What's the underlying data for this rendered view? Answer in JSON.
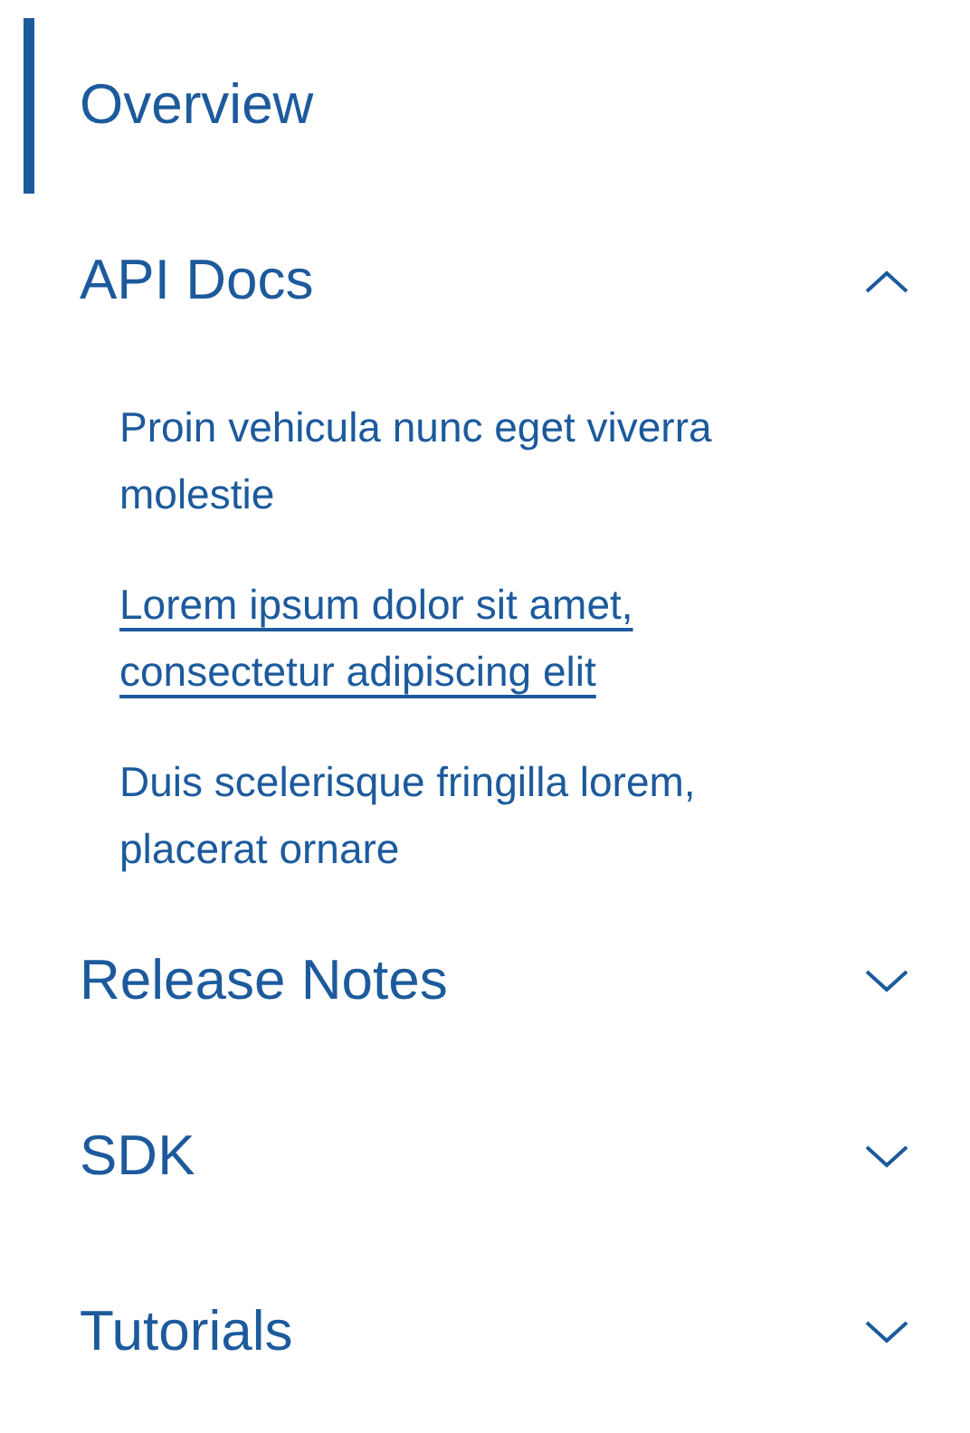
{
  "nav": {
    "items": [
      {
        "label": "Overview",
        "kind": "link",
        "selected": true
      },
      {
        "label": "API Docs",
        "kind": "section",
        "selected": false,
        "expanded": true,
        "children": [
          {
            "label": "Proin vehicula nunc eget viverra molestie",
            "hovered": false
          },
          {
            "label": "Lorem ipsum dolor sit amet, consectetur adipiscing elit",
            "hovered": true
          },
          {
            "label": "Duis scelerisque fringilla lorem, placerat ornare",
            "hovered": false
          }
        ]
      },
      {
        "label": "Release Notes",
        "kind": "section",
        "selected": false,
        "expanded": false
      },
      {
        "label": "SDK",
        "kind": "section",
        "selected": false,
        "expanded": false
      },
      {
        "label": "Tutorials",
        "kind": "section",
        "selected": false,
        "expanded": false
      }
    ]
  }
}
